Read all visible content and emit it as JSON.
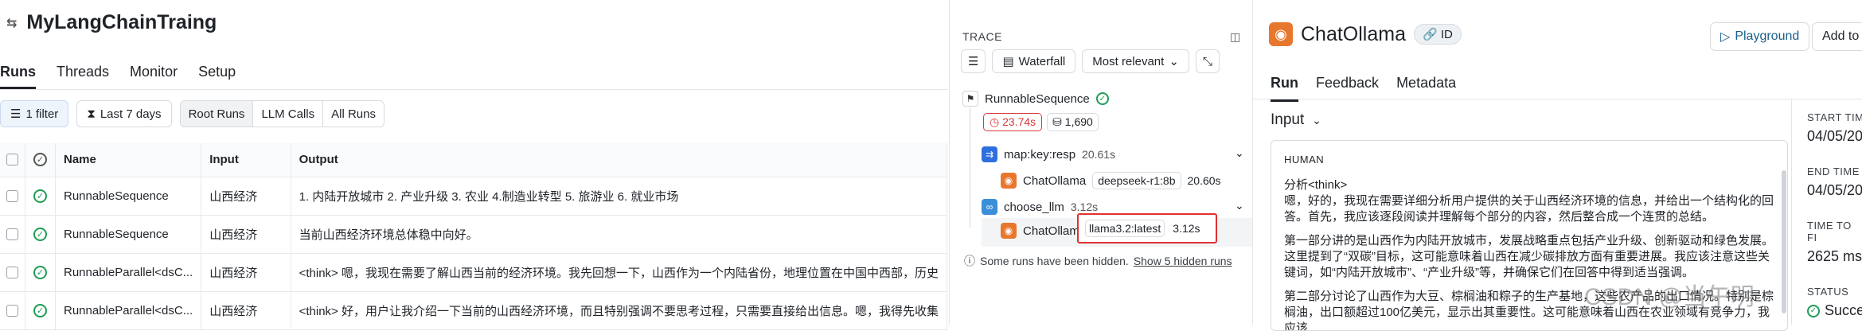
{
  "project": {
    "title": "MyLangChainTraing"
  },
  "tabs": [
    {
      "label": "Runs"
    },
    {
      "label": "Threads"
    },
    {
      "label": "Monitor"
    },
    {
      "label": "Setup"
    }
  ],
  "filters": {
    "filter_label": "1 filter",
    "time_label": "Last 7 days",
    "run_types": [
      {
        "label": "Root Runs"
      },
      {
        "label": "LLM Calls"
      },
      {
        "label": "All Runs"
      }
    ]
  },
  "table": {
    "headers": {
      "name": "Name",
      "input": "Input",
      "output": "Output"
    },
    "rows": [
      {
        "name": "RunnableSequence",
        "input": "山西经济",
        "output": "1. 内陆开放城市 2. 产业升级 3. 农业 4.制造业转型 5. 旅游业 6. 就业市场"
      },
      {
        "name": "RunnableSequence",
        "input": "山西经济",
        "output": "当前山西经济环境总体稳中向好。"
      },
      {
        "name": "RunnableParallel<dsC...",
        "input": "山西经济",
        "output": "<think> 嗯，我现在需要了解山西当前的经济环境。我先回想一下，山西作为一个内陆省份，地理位置在中国中西部，历史"
      },
      {
        "name": "RunnableParallel<dsC...",
        "input": "山西经济",
        "output": "<think> 好，用户让我介绍一下当前的山西经济环境，而且特别强调不要思考过程，只需要直接给出信息。嗯，我得先收集"
      }
    ]
  },
  "trace": {
    "label": "TRACE",
    "view_label": "Waterfall",
    "sort_label": "Most relevant",
    "root": {
      "name": "RunnableSequence",
      "latency": "23.74s",
      "tokens": "1,690"
    },
    "map": {
      "name": "map:key:resp",
      "latency": "20.61s"
    },
    "child1": {
      "name": "ChatOllama",
      "model": "deepseek-r1:8b",
      "latency": "20.60s"
    },
    "choose": {
      "name": "choose_llm",
      "latency": "3.12s"
    },
    "child2": {
      "name": "ChatOllama",
      "model": "llama3.2:latest",
      "latency": "3.12s"
    },
    "hidden_text": "Some runs have been hidden.",
    "hidden_link": "Show 5 hidden runs"
  },
  "detail": {
    "title": "ChatOllama",
    "id_label": "ID",
    "playground_label": "Playground",
    "add_label": "Add to",
    "tabs": [
      {
        "label": "Run"
      },
      {
        "label": "Feedback"
      },
      {
        "label": "Metadata"
      }
    ],
    "input_label": "Input",
    "role_label": "HUMAN",
    "paragraphs": [
      "分析<think>",
      "嗯，好的，我现在需要详细分析用户提供的关于山西经济环境的信息，并给出一个结构化的回答。首先，我应该逐段阅读并理解每个部分的内容，然后整合成一个连贯的总结。",
      "第一部分讲的是山西作为内陆开放城市，发展战略重点包括产业升级、创新驱动和绿色发展。这里提到了“双碳”目标，这可能意味着山西在减少碳排放方面有重要进展。我应该注意这些关键词，如“内陆开放城市”、“产业升级”等，并确保它们在回答中得到适当强调。",
      "第二部分讨论了山西作为大豆、棕榈油和粽子的生产基地，这些农产品的出口情况。特别是棕榈油，出口额超过100亿美元，显示出其重要性。这可能意味着山西在农业领域有竞争力，我应该"
    ],
    "meta": {
      "start_label": "START TIM",
      "start_val": "04/05/20",
      "end_label": "END TIME",
      "end_val": "04/05/20",
      "ttf_label": "TIME TO FI",
      "ttf_val": "2625 ms",
      "status_label": "STATUS",
      "status_val": "Succe"
    }
  },
  "watermark": "CSDN @当午明"
}
